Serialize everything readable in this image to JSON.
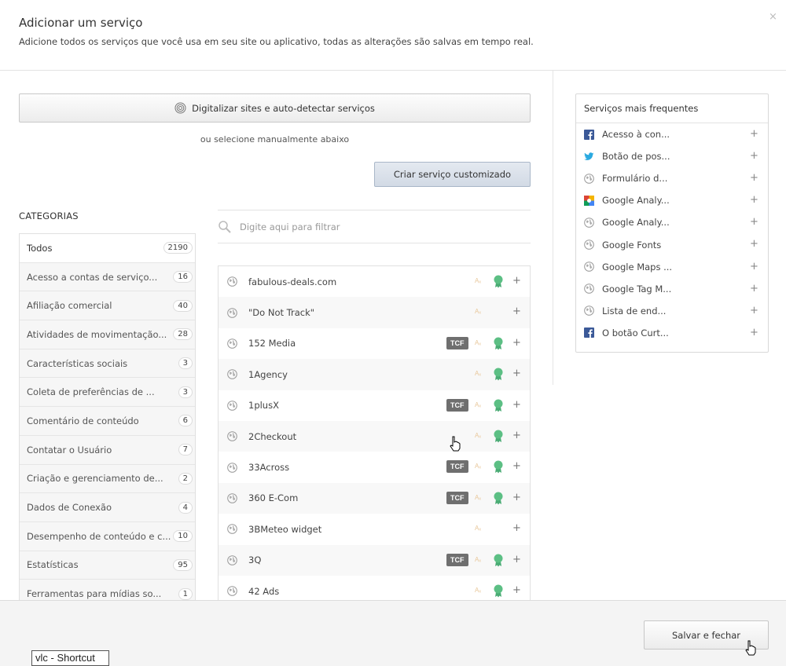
{
  "header": {
    "title": "Adicionar um serviço",
    "subtitle": "Adicione todos os serviços que você usa em seu site ou aplicativo, todas as alterações são salvas em tempo real.",
    "close_label": "×"
  },
  "scan_button": {
    "label": "Digitalizar sites e auto-detectar serviços",
    "icon": "fingerprint-icon"
  },
  "manual_text": "ou selecione manualmente abaixo",
  "custom_button": {
    "label": "Criar serviço customizado"
  },
  "categories": {
    "title": "CATEGORIAS",
    "items": [
      {
        "label": "Todos",
        "count": "2190"
      },
      {
        "label": "Acesso a contas de serviço...",
        "count": "16"
      },
      {
        "label": "Afiliação comercial",
        "count": "40"
      },
      {
        "label": "Atividades de movimentação...",
        "count": "28"
      },
      {
        "label": "Características sociais",
        "count": "3"
      },
      {
        "label": "Coleta de preferências de ...",
        "count": "3"
      },
      {
        "label": "Comentário de conteúdo",
        "count": "6"
      },
      {
        "label": "Contatar o Usuário",
        "count": "7"
      },
      {
        "label": "Criação e gerenciamento de...",
        "count": "2"
      },
      {
        "label": "Dados de Conexão",
        "count": "4"
      },
      {
        "label": "Desempenho de conteúdo e c...",
        "count": "10"
      },
      {
        "label": "Estatísticas",
        "count": "95"
      },
      {
        "label": "Ferramentas para mídias so...",
        "count": "1"
      }
    ]
  },
  "filter": {
    "placeholder": "Digite aqui para filtrar"
  },
  "services": {
    "tcf_label": "TCF",
    "az_label": "Aₓ",
    "plus_label": "+",
    "items": [
      {
        "name": "fabulous-deals.com",
        "tcf": false,
        "award": true
      },
      {
        "name": "\"Do Not Track\"",
        "tcf": false,
        "award": false
      },
      {
        "name": "152 Media",
        "tcf": true,
        "award": true
      },
      {
        "name": "1Agency",
        "tcf": false,
        "award": true
      },
      {
        "name": "1plusX",
        "tcf": true,
        "award": true
      },
      {
        "name": "2Checkout",
        "tcf": false,
        "award": true
      },
      {
        "name": "33Across",
        "tcf": true,
        "award": true
      },
      {
        "name": "360 E-Com",
        "tcf": true,
        "award": true
      },
      {
        "name": "3BMeteo widget",
        "tcf": false,
        "award": false
      },
      {
        "name": "3Q",
        "tcf": true,
        "award": true
      },
      {
        "name": "42 Ads",
        "tcf": false,
        "award": true
      }
    ]
  },
  "frequent": {
    "title": "Serviços mais frequentes",
    "plus_label": "+",
    "items": [
      {
        "label": "Acesso à con...",
        "icon": "facebook-icon"
      },
      {
        "label": "Botão de pos...",
        "icon": "twitter-icon"
      },
      {
        "label": "Formulário d...",
        "icon": "globe-icon"
      },
      {
        "label": "Google Analy...",
        "icon": "google-analytics-icon"
      },
      {
        "label": "Google Analy...",
        "icon": "globe-icon"
      },
      {
        "label": "Google Fonts",
        "icon": "globe-icon"
      },
      {
        "label": "Google Maps ...",
        "icon": "globe-icon"
      },
      {
        "label": "Google Tag M...",
        "icon": "globe-icon"
      },
      {
        "label": "Lista de end...",
        "icon": "globe-icon"
      },
      {
        "label": "O botão Curt...",
        "icon": "facebook-icon"
      }
    ]
  },
  "footer": {
    "save_label": "Salvar e fechar"
  },
  "tooltip": {
    "text": "vlc - Shortcut"
  },
  "colors": {
    "award": "#5cbf84",
    "tcf_bg": "#6f6f6f",
    "facebook": "#3b5998",
    "twitter": "#2aa9e0"
  }
}
